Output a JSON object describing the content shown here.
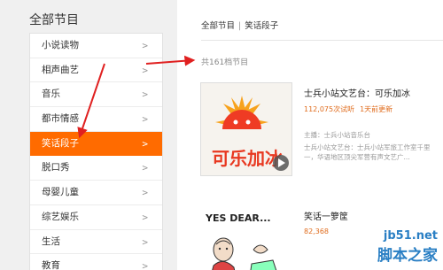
{
  "sidebar": {
    "title": "全部节目",
    "items": [
      {
        "label": "小说读物",
        "active": false
      },
      {
        "label": "相声曲艺",
        "active": false
      },
      {
        "label": "音乐",
        "active": false
      },
      {
        "label": "都市情感",
        "active": false
      },
      {
        "label": "笑话段子",
        "active": true
      },
      {
        "label": "脱口秀",
        "active": false
      },
      {
        "label": "母婴儿童",
        "active": false
      },
      {
        "label": "综艺娱乐",
        "active": false
      },
      {
        "label": "生活",
        "active": false
      },
      {
        "label": "教育",
        "active": false
      }
    ],
    "arrow_glyph": ">"
  },
  "main": {
    "breadcrumb": {
      "root": "全部节目",
      "separator": "|",
      "current": "笑话段子"
    },
    "count_text": "共161档节目",
    "programs": [
      {
        "title": "士兵小站文艺台：可乐加冰",
        "plays": "112,075次试听",
        "updated": "1天前更新",
        "host": "主播：士兵小站音乐台",
        "description": "士兵小站文艺台：士兵小站军旅工作室千里一，华语地区顶尖军营有声文艺广...",
        "cover_text": "可乐加冰"
      },
      {
        "title": "笑话一箩筐",
        "plays": "82,368",
        "cover_text": "YES DEAR..."
      }
    ]
  },
  "watermark": {
    "site": "jb51.net",
    "name": "脚本之家"
  },
  "colors": {
    "active": "#ff6b00",
    "arrow": "#e02020",
    "accent_text": "#e06c1d"
  }
}
